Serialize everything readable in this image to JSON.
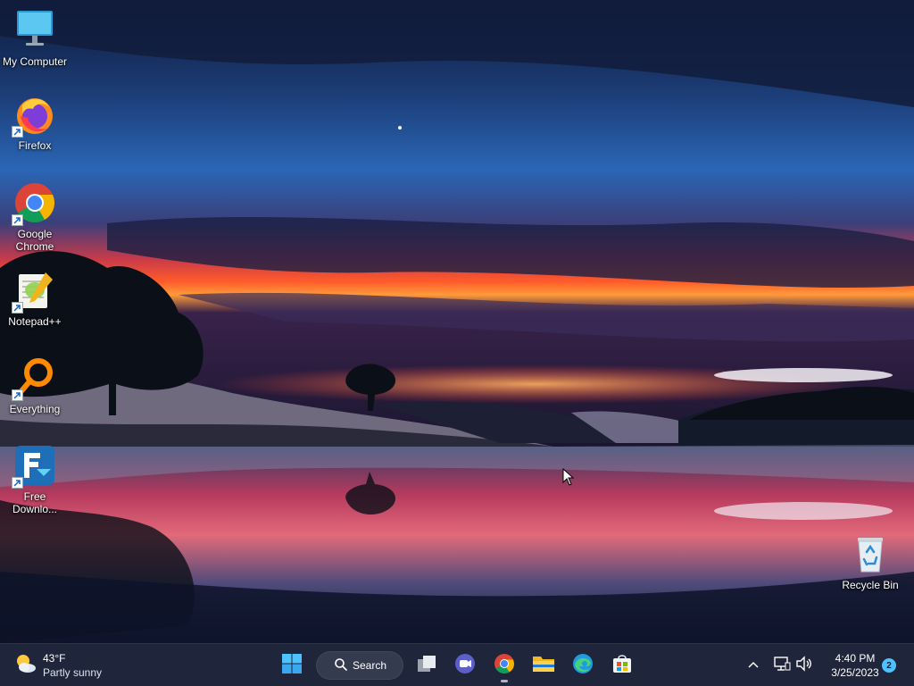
{
  "desktop": {
    "icons": [
      {
        "label": "My Computer",
        "icon": "monitor-icon",
        "shortcut": false
      },
      {
        "label": "Firefox",
        "icon": "firefox-icon",
        "shortcut": true
      },
      {
        "label": "Google Chrome",
        "icon": "chrome-icon",
        "shortcut": true
      },
      {
        "label": "Notepad++",
        "icon": "notepadpp-icon",
        "shortcut": true
      },
      {
        "label": "Everything",
        "icon": "everything-search-icon",
        "shortcut": true
      },
      {
        "label": "Free Downlo...",
        "icon": "free-download-manager-icon",
        "shortcut": true
      },
      {
        "label": "Recycle Bin",
        "icon": "recycle-bin-icon",
        "shortcut": false
      }
    ]
  },
  "taskbar": {
    "weather": {
      "temperature": "43°F",
      "condition": "Partly sunny",
      "icon": "partly-sunny-icon"
    },
    "start_icon": "windows-start-icon",
    "search": {
      "label": "Search",
      "icon": "search-icon"
    },
    "pinned": [
      {
        "name": "task-view",
        "icon": "task-view-icon"
      },
      {
        "name": "teams-chat",
        "icon": "teams-chat-icon"
      },
      {
        "name": "chrome",
        "icon": "chrome-icon",
        "running": true
      },
      {
        "name": "file-explorer",
        "icon": "folder-icon"
      },
      {
        "name": "edge",
        "icon": "edge-icon"
      },
      {
        "name": "microsoft-store",
        "icon": "store-icon"
      }
    ],
    "tray": {
      "icons": [
        "chevron-up-icon",
        "network-icon",
        "volume-icon"
      ],
      "time": "4:40 PM",
      "date": "3/25/2023",
      "notification_count": "2"
    }
  },
  "colors": {
    "taskbar_bg": "#20263a",
    "accent": "#4cc2ff",
    "sunset_red": "#ff3b2e",
    "sky_blue": "#2f73c9"
  }
}
